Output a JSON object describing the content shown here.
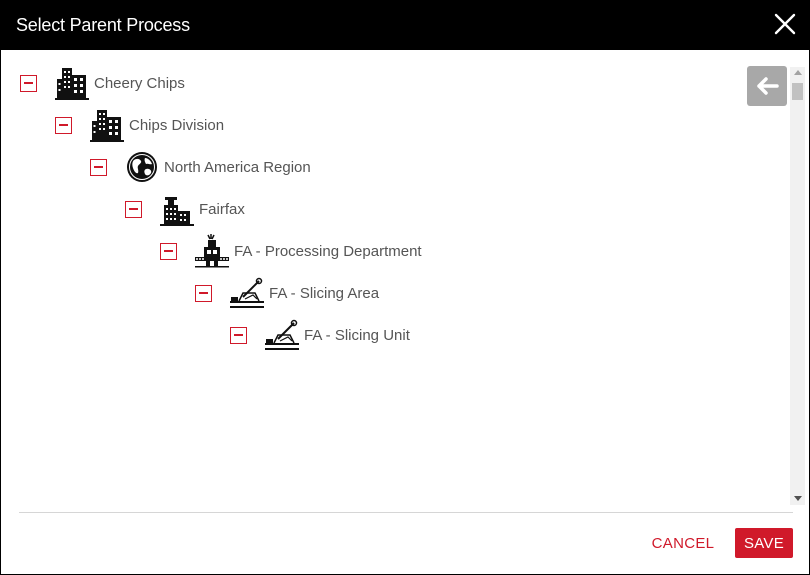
{
  "dialog": {
    "title": "Select Parent Process"
  },
  "tree": {
    "nodes": [
      {
        "label": "Cheery Chips",
        "icon": "company-building-icon",
        "expanded": true
      },
      {
        "label": "Chips Division",
        "icon": "division-building-icon",
        "expanded": true
      },
      {
        "label": "North America Region",
        "icon": "globe-icon",
        "expanded": true
      },
      {
        "label": "Fairfax",
        "icon": "factory-icon",
        "expanded": true
      },
      {
        "label": "FA - Processing Department",
        "icon": "processing-machine-icon",
        "expanded": true
      },
      {
        "label": "FA - Slicing Area",
        "icon": "slicer-icon",
        "expanded": true
      },
      {
        "label": "FA - Slicing Unit",
        "icon": "slicer-icon",
        "expanded": true
      }
    ]
  },
  "footer": {
    "cancel_label": "CANCEL",
    "save_label": "SAVE"
  },
  "colors": {
    "accent": "#d0192a",
    "titlebar": "#000000",
    "label_text": "#555555"
  }
}
